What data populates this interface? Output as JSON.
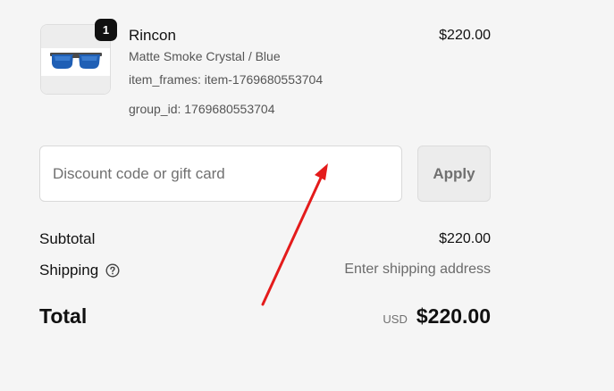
{
  "line_item": {
    "quantity": "1",
    "name": "Rincon",
    "price": "$220.00",
    "variant": "Matte Smoke Crystal / Blue",
    "frames": "item_frames: item-1769680553704",
    "group": "group_id: 1769680553704",
    "thumbnail_icon": "sunglasses-icon"
  },
  "discount": {
    "placeholder": "Discount code or gift card",
    "value": "",
    "apply_label": "Apply"
  },
  "summary": {
    "subtotal_label": "Subtotal",
    "subtotal_value": "$220.00",
    "shipping_label": "Shipping",
    "shipping_help_icon": "question-circle-icon",
    "shipping_value": "Enter shipping address",
    "total_label": "Total",
    "currency": "USD",
    "total_value": "$220.00"
  },
  "colors": {
    "background": "#f5f5f5",
    "text": "#111111",
    "muted_text": "#555555",
    "badge": "#111111",
    "annotation_arrow": "#e41b1b"
  }
}
